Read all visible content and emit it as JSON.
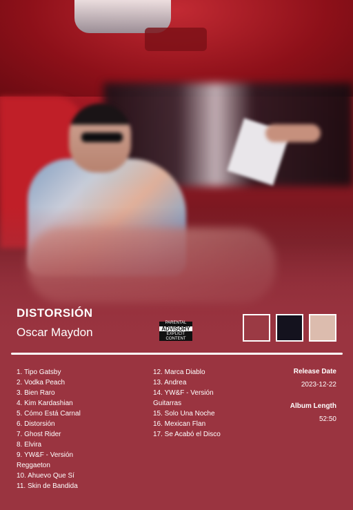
{
  "album": {
    "title": "DISTORSIÓN",
    "artist": "Oscar Maydon"
  },
  "advisory": {
    "top": "PARENTAL",
    "middle": "ADVISORY",
    "bottom": "EXPLICIT CONTENT"
  },
  "palette": [
    "#9b3a44",
    "#14121e",
    "#dcbcae"
  ],
  "tracks_col1": [
    "1. Tipo Gatsby",
    "2. Vodka Peach",
    "3. Bien Raro",
    "4. Kim Kardashian",
    "5. Cómo Está Carnal",
    "6. Distorsión",
    "7. Ghost Rider",
    "8. Elvira",
    "9. YW&F - Versión",
    "Reggaeton",
    "10. Ahuevo Que Sí",
    "11. Skin de Bandida"
  ],
  "tracks_col2": [
    "12. Marca Diablo",
    "13. Andrea",
    "14. YW&F - Versión",
    "Guitarras",
    "15. Solo Una Noche",
    "16. Mexican Flan",
    "17. Se Acabó el Disco"
  ],
  "meta": {
    "release_label": "Release Date",
    "release_value": "2023-12-22",
    "length_label": "Album Length",
    "length_value": "52:50"
  }
}
